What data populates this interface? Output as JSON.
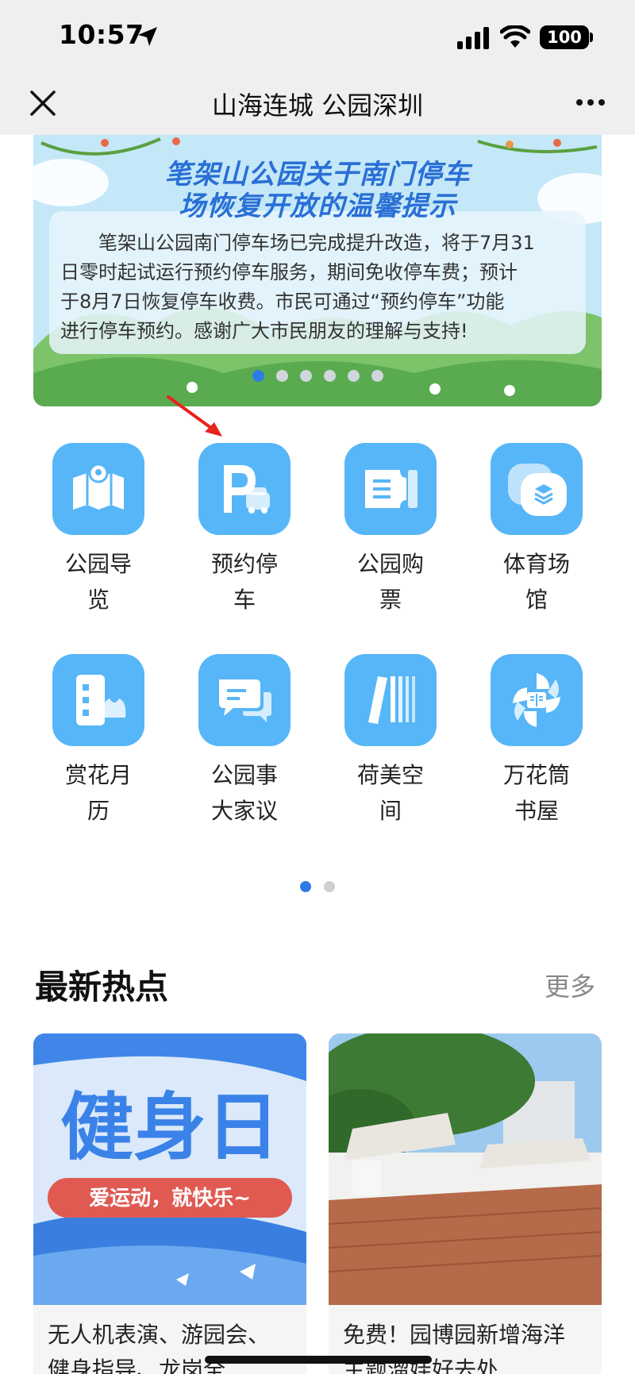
{
  "status": {
    "time": "10:57",
    "battery": "100"
  },
  "nav": {
    "title": "山海连城 公园深圳"
  },
  "banner": {
    "title_line1": "笔架山公园关于南门停车",
    "title_line2": "场恢复开放的温馨提示",
    "body_lines": [
      "　　笔架山公园南门停车场已完成提升改造，将于7月31",
      "日零时起试运行预约停车服务，期间免收停车费；预计",
      "于8月7日恢复停车收费。市民可通过“预约停车”功能",
      "进行停车预约。感谢广大市民朋友的理解与支持!"
    ],
    "dot_count": 6,
    "active_dot": 0
  },
  "tiles": [
    {
      "line1": "公园导",
      "line2": "览",
      "icon": "map-icon"
    },
    {
      "line1": "预约停",
      "line2": "车",
      "icon": "parking-icon"
    },
    {
      "line1": "公园购",
      "line2": "票",
      "icon": "ticket-icon"
    },
    {
      "line1": "体育场",
      "line2": "馆",
      "icon": "stadium-icon"
    },
    {
      "line1": "赏花月",
      "line2": "历",
      "icon": "flower-calendar-icon"
    },
    {
      "line1": "公园事",
      "line2": "大家议",
      "icon": "chat-icon"
    },
    {
      "line1": "荷美空",
      "line2": "间",
      "icon": "books-icon"
    },
    {
      "line1": "万花筒",
      "line2": "书屋",
      "icon": "kaleidoscope-book-icon"
    }
  ],
  "pager": {
    "count": 2,
    "active": 0
  },
  "hot": {
    "title": "最新热点",
    "more": "更多",
    "cards": [
      {
        "image_text": "健身日",
        "image_subtext": "爱运动，就快乐~",
        "line1": "无人机表演、游园会、",
        "line2": "健身指导、龙岗全"
      },
      {
        "line1": "免费！园博园新增海洋",
        "line2": "主题溜娃好去处"
      }
    ]
  },
  "colors": {
    "accent": "#2f7be6",
    "tile": "#57b6f7",
    "banner_title": "#2a6fd6",
    "bar": "#efefef"
  }
}
